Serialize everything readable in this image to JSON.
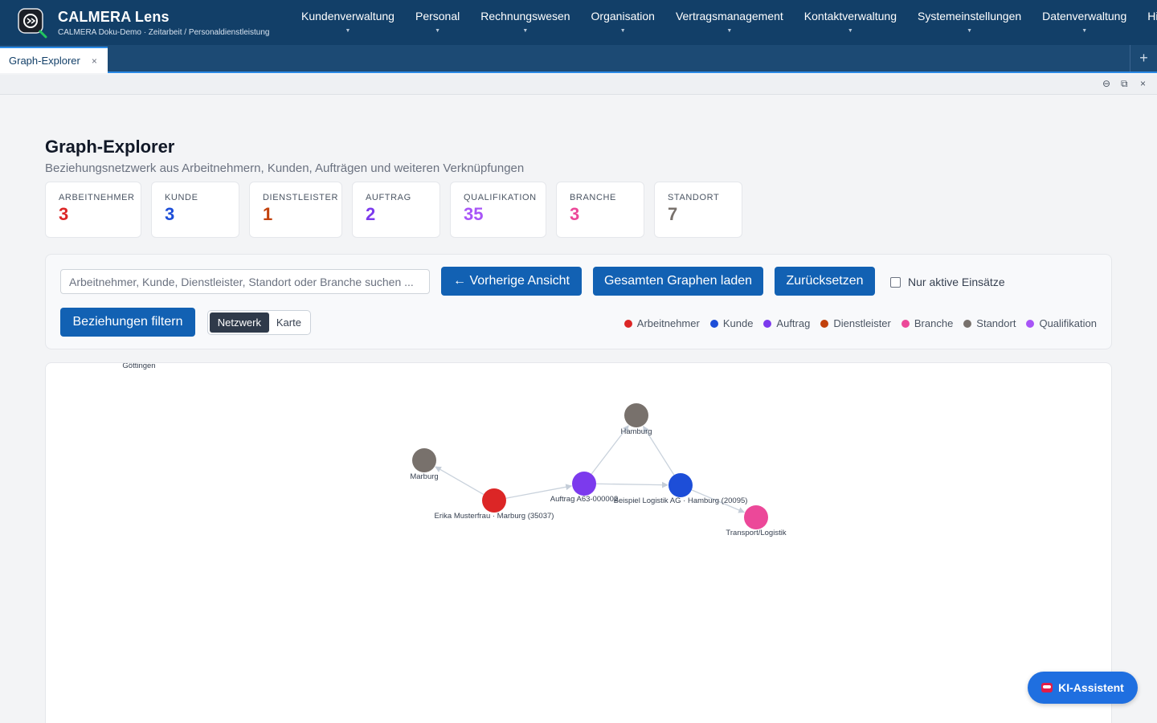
{
  "app": {
    "title": "CALMERA Lens",
    "subtitle": "CALMERA Doku-Demo · Zeitarbeit / Personaldienstleistung"
  },
  "nav": [
    {
      "label": "Kundenverwaltung"
    },
    {
      "label": "Personal"
    },
    {
      "label": "Rechnungswesen"
    },
    {
      "label": "Organisation"
    },
    {
      "label": "Vertragsmanagement"
    },
    {
      "label": "Kontaktverwaltung"
    },
    {
      "label": "Systemeinstellungen"
    },
    {
      "label": "Datenverwaltung"
    },
    {
      "label": "Hilfebe"
    }
  ],
  "tabs": [
    {
      "label": "Graph-Explorer",
      "close": "×"
    }
  ],
  "tab_add": "+",
  "window_tools": {
    "minimize": "⊖",
    "restore": "⧉",
    "close": "×"
  },
  "page": {
    "title": "Graph-Explorer",
    "subtitle": "Beziehungsnetzwerk aus Arbeitnehmern, Kunden, Aufträgen und weiteren Verknüpfungen"
  },
  "stats": [
    {
      "label": "ARBEITNEHMER",
      "value": "3",
      "color": "#dc2626"
    },
    {
      "label": "KUNDE",
      "value": "3",
      "color": "#1d4ed8"
    },
    {
      "label": "DIENSTLEISTER",
      "value": "1",
      "color": "#c2410c"
    },
    {
      "label": "AUFTRAG",
      "value": "2",
      "color": "#7c3aed"
    },
    {
      "label": "QUALIFIKATION",
      "value": "35",
      "color": "#a855f7"
    },
    {
      "label": "BRANCHE",
      "value": "3",
      "color": "#ec4899"
    },
    {
      "label": "STANDORT",
      "value": "7",
      "color": "#78716c"
    }
  ],
  "toolbar": {
    "search_placeholder": "Arbeitnehmer, Kunde, Dienstleister, Standort oder Branche suchen ...",
    "prev_view": "← Vorherige Ansicht",
    "load_full": "Gesamten Graphen laden",
    "reset": "Zurücksetzen",
    "only_active": "Nur aktive Einsätze",
    "filter": "Beziehungen filtern",
    "view_network": "Netzwerk",
    "view_map": "Karte"
  },
  "legend": [
    {
      "label": "Arbeitnehmer",
      "color": "#dc2626"
    },
    {
      "label": "Kunde",
      "color": "#1d4ed8"
    },
    {
      "label": "Auftrag",
      "color": "#7c3aed"
    },
    {
      "label": "Dienstleister",
      "color": "#c2410c"
    },
    {
      "label": "Branche",
      "color": "#ec4899"
    },
    {
      "label": "Standort",
      "color": "#78716c"
    },
    {
      "label": "Qualifikation",
      "color": "#a855f7"
    }
  ],
  "graph": {
    "nodes": [
      {
        "id": "goettingen",
        "label": "Göttingen",
        "type": "Standort",
        "color": "#78716c"
      },
      {
        "id": "hamburg",
        "label": "Hamburg",
        "type": "Standort",
        "color": "#78716c"
      },
      {
        "id": "marburg",
        "label": "Marburg",
        "type": "Standort",
        "color": "#78716c"
      },
      {
        "id": "erika",
        "label": "Erika Musterfrau · Marburg (35037)",
        "type": "Arbeitnehmer",
        "color": "#dc2626"
      },
      {
        "id": "auftrag",
        "label": "Auftrag A63-000002",
        "type": "Auftrag",
        "color": "#7c3aed"
      },
      {
        "id": "kunde",
        "label": "Beispiel Logistik AG · Hamburg (20095)",
        "type": "Kunde",
        "color": "#1d4ed8"
      },
      {
        "id": "branche",
        "label": "Transport/Logistik",
        "type": "Branche",
        "color": "#ec4899"
      }
    ],
    "edges": [
      {
        "from": "erika",
        "to": "marburg"
      },
      {
        "from": "erika",
        "to": "auftrag"
      },
      {
        "from": "auftrag",
        "to": "kunde"
      },
      {
        "from": "auftrag",
        "to": "hamburg"
      },
      {
        "from": "kunde",
        "to": "hamburg"
      },
      {
        "from": "kunde",
        "to": "branche"
      }
    ]
  },
  "ai_assistant": "KI-Assistent"
}
